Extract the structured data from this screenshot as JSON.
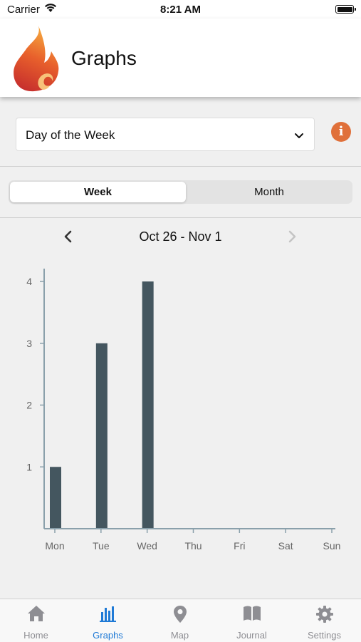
{
  "status_bar": {
    "carrier": "Carrier",
    "time": "8:21 AM"
  },
  "header": {
    "title": "Graphs"
  },
  "filter": {
    "selected": "Day of the Week"
  },
  "info_icon_glyph": "i",
  "segments": [
    {
      "label": "Week",
      "active": true
    },
    {
      "label": "Month",
      "active": false
    }
  ],
  "range": {
    "label": "Oct 26 - Nov 1"
  },
  "chart_data": {
    "type": "bar",
    "categories": [
      "Mon",
      "Tue",
      "Wed",
      "Thu",
      "Fri",
      "Sat",
      "Sun"
    ],
    "values": [
      1,
      3,
      4,
      0,
      0,
      0,
      0
    ],
    "ylim": [
      0,
      4
    ],
    "yticks": [
      1,
      2,
      3,
      4
    ],
    "bar_color": "#44565f",
    "axis_color": "#8aa0ab"
  },
  "tabs": [
    {
      "label": "Home",
      "icon": "home-icon",
      "active": false
    },
    {
      "label": "Graphs",
      "icon": "bar-chart-icon",
      "active": true
    },
    {
      "label": "Map",
      "icon": "map-pin-icon",
      "active": false
    },
    {
      "label": "Journal",
      "icon": "book-icon",
      "active": false
    },
    {
      "label": "Settings",
      "icon": "gear-icon",
      "active": false
    }
  ],
  "colors": {
    "accent": "#1f7ad6",
    "info": "#e0703a",
    "inactive_tab": "#8e8e93"
  }
}
